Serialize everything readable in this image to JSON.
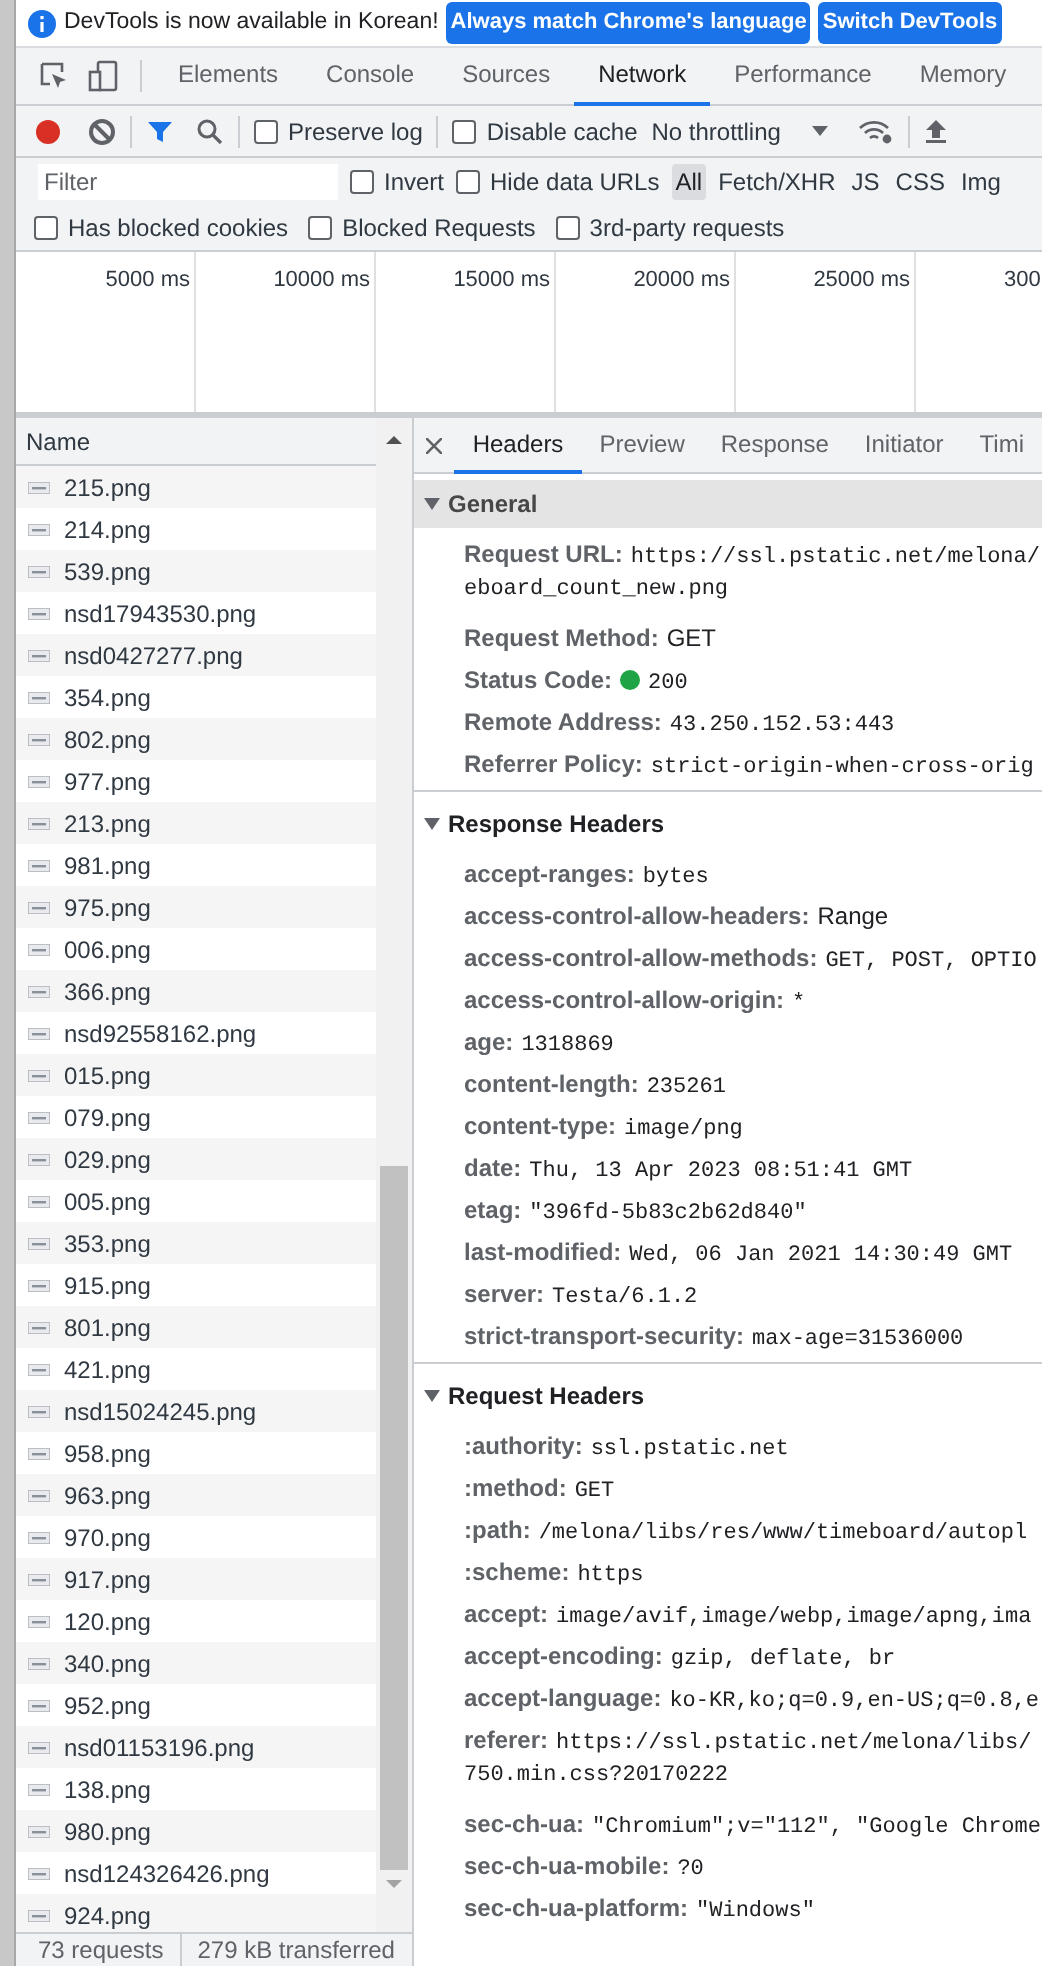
{
  "infobar": {
    "message": "DevTools is now available in Korean!",
    "buttons": [
      "Always match Chrome's language",
      "Switch DevTools"
    ]
  },
  "tabs": [
    {
      "label": "Elements",
      "selected": false
    },
    {
      "label": "Console",
      "selected": false
    },
    {
      "label": "Sources",
      "selected": false
    },
    {
      "label": "Network",
      "selected": true
    },
    {
      "label": "Performance",
      "selected": false
    },
    {
      "label": "Memory",
      "selected": false
    }
  ],
  "toolbar": {
    "recording": true,
    "filter_active": true,
    "preserve_log": {
      "label": "Preserve log",
      "checked": false
    },
    "disable_cache": {
      "label": "Disable cache",
      "checked": false
    },
    "throttling": "No throttling"
  },
  "filter_bar": {
    "placeholder": "Filter",
    "invert": {
      "label": "Invert",
      "checked": false
    },
    "hide_data_urls": {
      "label": "Hide data URLs",
      "checked": false
    },
    "types": [
      {
        "label": "All",
        "selected": true
      },
      {
        "label": "Fetch/XHR",
        "selected": false
      },
      {
        "label": "JS",
        "selected": false
      },
      {
        "label": "CSS",
        "selected": false
      },
      {
        "label": "Img",
        "selected": false
      }
    ]
  },
  "extra_filters": [
    {
      "label": "Has blocked cookies",
      "checked": false
    },
    {
      "label": "Blocked Requests",
      "checked": false
    },
    {
      "label": "3rd-party requests",
      "checked": false
    }
  ],
  "overview": {
    "ticks": [
      "5000 ms",
      "10000 ms",
      "15000 ms",
      "20000 ms",
      "25000 ms",
      "300"
    ]
  },
  "requests": {
    "column": "Name",
    "rows": [
      "215.png",
      "214.png",
      "539.png",
      "nsd17943530.png",
      "nsd0427277.png",
      "354.png",
      "802.png",
      "977.png",
      "213.png",
      "981.png",
      "975.png",
      "006.png",
      "366.png",
      "nsd92558162.png",
      "015.png",
      "079.png",
      "029.png",
      "005.png",
      "353.png",
      "915.png",
      "801.png",
      "421.png",
      "nsd15024245.png",
      "958.png",
      "963.png",
      "970.png",
      "917.png",
      "120.png",
      "340.png",
      "952.png",
      "nsd01153196.png",
      "138.png",
      "980.png",
      "nsd124326426.png",
      "924.png"
    ]
  },
  "details": {
    "tabs": [
      {
        "label": "Headers",
        "selected": true
      },
      {
        "label": "Preview",
        "selected": false
      },
      {
        "label": "Response",
        "selected": false
      },
      {
        "label": "Initiator",
        "selected": false
      },
      {
        "label": "Timi",
        "selected": false
      }
    ],
    "sections": [
      {
        "title": "General",
        "expanded": true,
        "shaded": true,
        "rows": [
          {
            "label": "Request URL:",
            "value": "https://ssl.pstatic.net/melona/",
            "continuation": "eboard_count_new.png",
            "mono": true
          },
          {
            "label": "Request Method:",
            "value": "GET",
            "mono": false
          },
          {
            "label": "Status Code:",
            "value": "200",
            "color": "#1ea446",
            "mono": true
          },
          {
            "label": "Remote Address:",
            "value": "43.250.152.53:443",
            "mono": true
          },
          {
            "label": "Referrer Policy:",
            "value": "strict-origin-when-cross-orig",
            "mono": true
          }
        ]
      },
      {
        "title": "Response Headers",
        "expanded": true,
        "shaded": false,
        "rows": [
          {
            "label": "accept-ranges:",
            "value": "bytes",
            "mono": true
          },
          {
            "label": "access-control-allow-headers:",
            "value": "Range",
            "mono": false
          },
          {
            "label": "access-control-allow-methods:",
            "value": "GET, POST, OPTIO",
            "mono": true
          },
          {
            "label": "access-control-allow-origin:",
            "value": "*",
            "mono": true
          },
          {
            "label": "age:",
            "value": "1318869",
            "mono": true
          },
          {
            "label": "content-length:",
            "value": "235261",
            "mono": true
          },
          {
            "label": "content-type:",
            "value": "image/png",
            "mono": true
          },
          {
            "label": "date:",
            "value": "Thu, 13 Apr 2023 08:51:41 GMT",
            "mono": true
          },
          {
            "label": "etag:",
            "value": "\"396fd-5b83c2b62d840\"",
            "mono": true
          },
          {
            "label": "last-modified:",
            "value": "Wed, 06 Jan 2021 14:30:49 GMT",
            "mono": true
          },
          {
            "label": "server:",
            "value": "Testa/6.1.2",
            "mono": true
          },
          {
            "label": "strict-transport-security:",
            "value": "max-age=31536000",
            "mono": true
          }
        ]
      },
      {
        "title": "Request Headers",
        "expanded": true,
        "shaded": false,
        "rows": [
          {
            "label": ":authority:",
            "value": "ssl.pstatic.net",
            "mono": true
          },
          {
            "label": ":method:",
            "value": "GET",
            "mono": true
          },
          {
            "label": ":path:",
            "value": "/melona/libs/res/www/timeboard/autopl",
            "mono": true
          },
          {
            "label": ":scheme:",
            "value": "https",
            "mono": true
          },
          {
            "label": "accept:",
            "value": "image/avif,image/webp,image/apng,ima",
            "mono": true
          },
          {
            "label": "accept-encoding:",
            "value": "gzip, deflate, br",
            "mono": true
          },
          {
            "label": "accept-language:",
            "value": "ko-KR,ko;q=0.9,en-US;q=0.8,e",
            "mono": true
          },
          {
            "label": "referer:",
            "value": "https://ssl.pstatic.net/melona/libs/",
            "continuation": "750.min.css?20170222",
            "mono": true
          },
          {
            "label": "sec-ch-ua:",
            "value": "\"Chromium\";v=\"112\", \"Google Chrome",
            "mono": true
          },
          {
            "label": "sec-ch-ua-mobile:",
            "value": "?0",
            "mono": true
          },
          {
            "label": "sec-ch-ua-platform:",
            "value": "\"Windows\"",
            "mono": true
          }
        ]
      }
    ]
  },
  "status_bar": [
    "73 requests",
    "279 kB transferred"
  ]
}
